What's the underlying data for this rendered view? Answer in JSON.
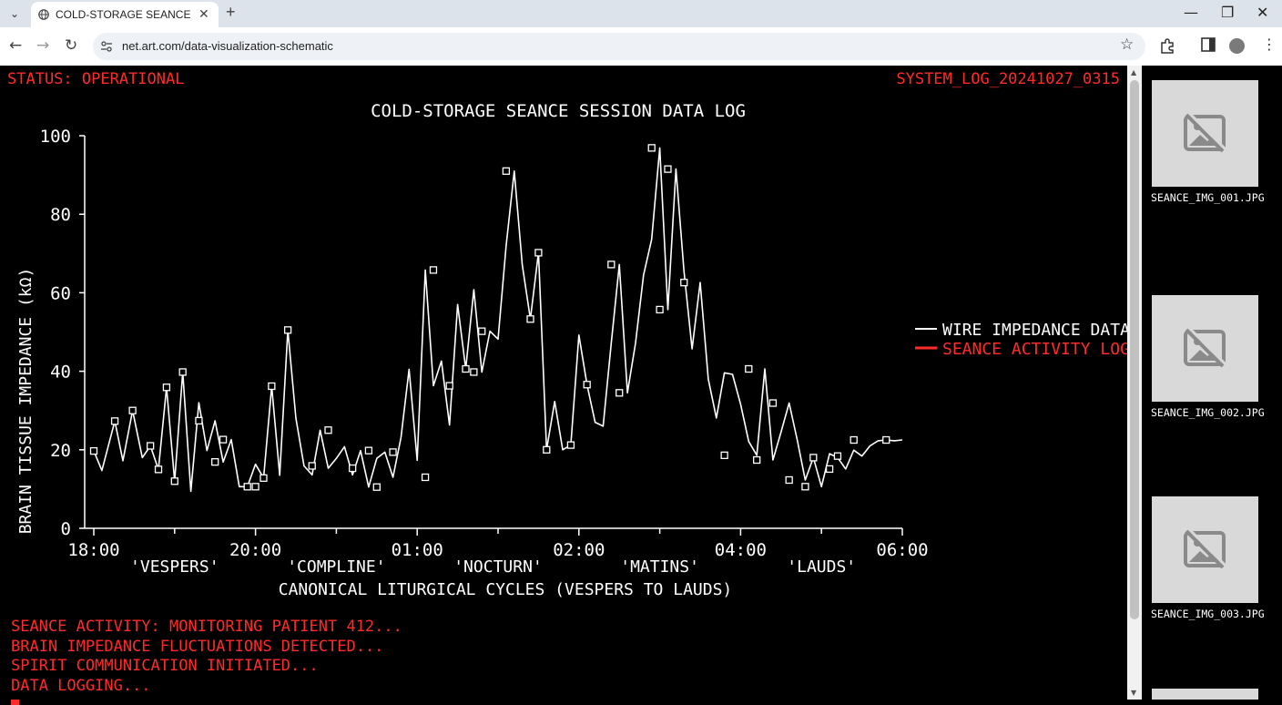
{
  "browser": {
    "tab_title": "COLD-STORAGE SEANCE SESSI",
    "url": "net.art.com/data-visualization-schematic",
    "icons": [
      "tab-list-icon",
      "globe-icon",
      "close-icon",
      "plus-icon",
      "minimize-icon",
      "restore-icon",
      "window-close-icon",
      "back-icon",
      "forward-icon",
      "reload-icon",
      "site-info-icon",
      "star-icon",
      "extensions-icon",
      "side-panel-icon",
      "profile-avatar",
      "more-menu-icon"
    ]
  },
  "header": {
    "status": "STATUS: OPERATIONAL",
    "log_id": "SYSTEM_LOG_20241027_0315"
  },
  "chart_data": {
    "type": "line",
    "title": "COLD-STORAGE SEANCE SESSION DATA LOG",
    "xlabel": "CANONICAL LITURGICAL CYCLES (VESPERS TO LAUDS)",
    "ylabel": "BRAIN TISSUE IMPEDANCE (kΩ)",
    "ylim": [
      0,
      100
    ],
    "yticks": [
      0,
      20,
      40,
      60,
      80,
      100
    ],
    "xlim": [
      0,
      12
    ],
    "xticks": [
      {
        "v": 0,
        "label": "18:00"
      },
      {
        "v": 2,
        "label": "20:00"
      },
      {
        "v": 4,
        "label": "01:00"
      },
      {
        "v": 6,
        "label": "02:00"
      },
      {
        "v": 8,
        "label": "04:00"
      },
      {
        "v": 10,
        "label": "06:00"
      }
    ],
    "period_labels": [
      {
        "v": 1,
        "label": "'VESPERS'"
      },
      {
        "v": 3,
        "label": "'COMPLINE'"
      },
      {
        "v": 5,
        "label": "'NOCTURN'"
      },
      {
        "v": 7,
        "label": "'MATINS'"
      },
      {
        "v": 9,
        "label": "'LAUDS'"
      }
    ],
    "legend": {
      "placement": "right",
      "entries": [
        "WIRE IMPEDANCE DATA",
        "SEANCE ACTIVITY LOG"
      ]
    },
    "colors": {
      "wire": "#ffffff",
      "seance": "#ff2a2a",
      "background": "#000000"
    },
    "series": [
      {
        "name": "WIRE IMPEDANCE DATA",
        "x": [
          0.0,
          0.1,
          0.26,
          0.36,
          0.48,
          0.6,
          0.7,
          0.8,
          0.9,
          1.0,
          1.1,
          1.2,
          1.3,
          1.4,
          1.5,
          1.6,
          1.7,
          1.8,
          1.9,
          2.0,
          2.1,
          2.2,
          2.3,
          2.4,
          2.5,
          2.6,
          2.7,
          2.8,
          2.9,
          3.0,
          3.1,
          3.2,
          3.3,
          3.4,
          3.5,
          3.6,
          3.7,
          3.8,
          3.9,
          4.0,
          4.1,
          4.2,
          4.3,
          4.4,
          4.5,
          4.6,
          4.7,
          4.8,
          4.9,
          5.0,
          5.1,
          5.2,
          5.3,
          5.4,
          5.5,
          5.6,
          5.7,
          5.8,
          5.9,
          6.0,
          6.1,
          6.2,
          6.3,
          6.4,
          6.5,
          6.6,
          6.7,
          6.8,
          6.9,
          7.0,
          7.1,
          7.2,
          7.3,
          7.4,
          7.5,
          7.6,
          7.7,
          7.8,
          7.9,
          8.0,
          8.1,
          8.2,
          8.3,
          8.4,
          8.5,
          8.6,
          8.7,
          8.8,
          8.9,
          9.0,
          9.1,
          9.2,
          9.3,
          9.4,
          9.5,
          9.6,
          9.7,
          9.8,
          9.9,
          10.0
        ],
        "values": [
          19.7,
          14.7,
          27.3,
          17.2,
          30.0,
          18.0,
          21.0,
          15.0,
          35.9,
          12.0,
          39.8,
          9.4,
          32.0,
          19.8,
          27.4,
          16.9,
          22.6,
          10.6,
          10.6,
          16.3,
          12.8,
          36.2,
          13.5,
          50.5,
          28.0,
          15.9,
          13.6,
          25.0,
          15.3,
          17.8,
          20.8,
          13.6,
          19.8,
          10.5,
          17.8,
          19.4,
          13.0,
          23.1,
          40.5,
          17.3,
          65.8,
          36.3,
          42.6,
          26.3,
          57.0,
          40.6,
          60.8,
          39.8,
          50.2,
          48.2,
          72.0,
          91.0,
          67.1,
          53.3,
          70.2,
          20.0,
          32.3,
          20.0,
          21.2,
          49.2,
          36.6,
          27.0,
          26.0,
          47.1,
          67.2,
          34.5,
          47.2,
          64.5,
          73.6,
          96.9,
          55.7,
          91.5,
          65.5,
          45.7,
          62.6,
          38.0,
          28.1,
          39.6,
          39.2,
          31.6,
          22.1,
          18.6,
          40.6,
          17.4,
          24.5,
          31.9,
          22.5,
          12.3,
          18.0,
          10.6,
          19.0,
          18.0,
          15.1,
          19.9,
          18.4,
          21.0,
          22.3,
          22.5,
          22.3,
          22.5
        ],
        "markers_x": [
          0.0,
          0.26,
          0.48,
          0.7,
          0.8,
          0.9,
          1.0,
          1.1,
          1.3,
          1.5,
          1.6,
          1.9,
          2.0,
          2.1,
          2.2,
          2.4,
          2.7,
          2.9,
          3.2,
          3.4,
          3.5,
          3.7,
          4.1,
          4.2,
          4.4,
          4.6,
          4.7,
          4.8,
          5.1,
          5.4,
          5.5,
          5.6,
          5.9,
          6.1,
          6.4,
          6.5,
          6.9,
          7.0,
          7.1,
          7.3,
          7.8,
          8.1,
          8.2,
          8.4,
          8.6,
          8.8,
          8.9,
          9.1,
          9.2,
          9.4,
          9.8
        ],
        "markers_y": [
          19.7,
          27.3,
          30.0,
          21.0,
          15.0,
          35.9,
          12.0,
          39.8,
          27.4,
          16.9,
          22.6,
          10.6,
          10.6,
          12.8,
          36.2,
          50.5,
          15.9,
          25.0,
          15.3,
          19.8,
          10.5,
          19.4,
          13.0,
          65.8,
          36.3,
          40.6,
          39.8,
          50.2,
          91.0,
          53.3,
          70.2,
          20.0,
          21.2,
          36.6,
          67.2,
          34.5,
          96.9,
          55.7,
          91.5,
          62.6,
          18.6,
          40.6,
          17.4,
          31.9,
          12.3,
          10.6,
          18.0,
          15.1,
          18.4,
          22.5,
          22.5
        ]
      },
      {
        "name": "SEANCE ACTIVITY LOG",
        "x": [],
        "values": []
      }
    ]
  },
  "console": {
    "lines": [
      "SEANCE ACTIVITY: MONITORING PATIENT 412...",
      "BRAIN IMPEDANCE FLUCTUATIONS DETECTED...",
      "SPIRIT COMMUNICATION INITIATED...",
      "DATA LOGGING..."
    ]
  },
  "gallery": {
    "images": [
      {
        "caption": "SEANCE_IMG_001.JPG",
        "icon": "broken-image-icon"
      },
      {
        "caption": "SEANCE_IMG_002.JPG",
        "icon": "broken-image-icon"
      },
      {
        "caption": "SEANCE_IMG_003.JPG",
        "icon": "broken-image-icon"
      }
    ]
  }
}
